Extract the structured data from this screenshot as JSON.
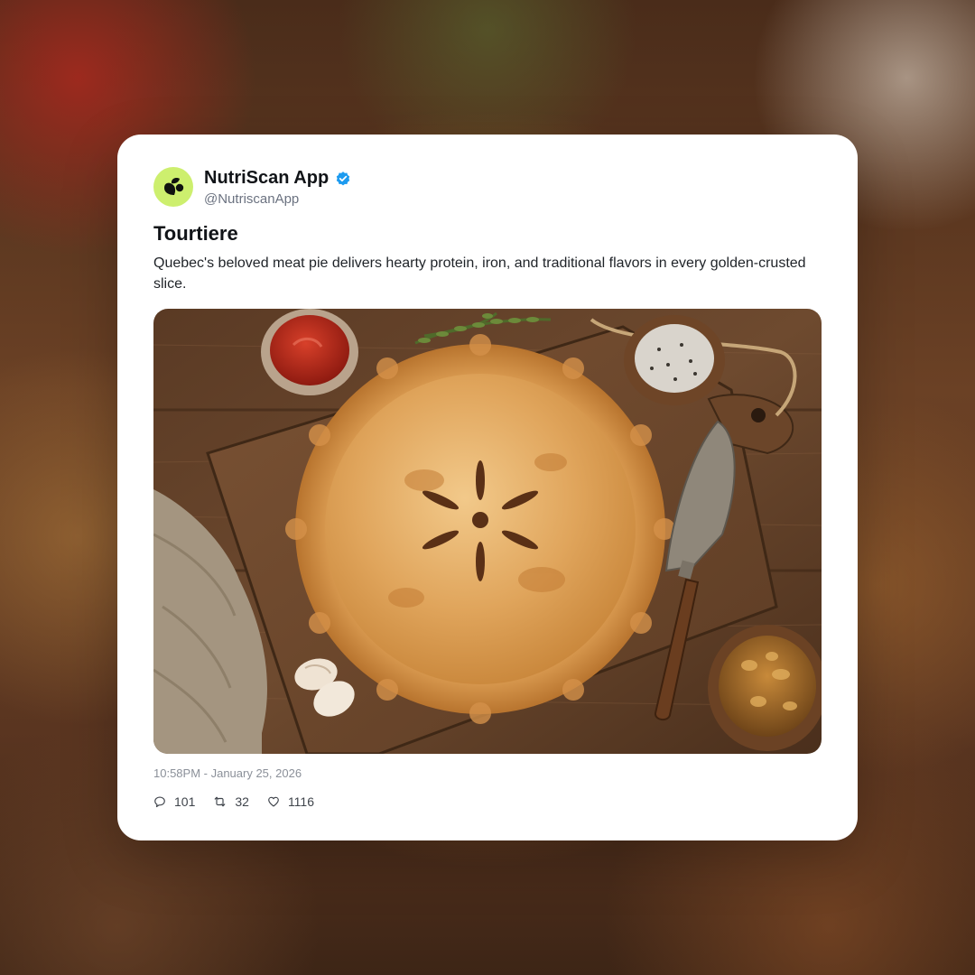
{
  "post": {
    "account_name": "NutriScan App",
    "handle": "@NutriscanApp",
    "verified": true,
    "title": "Tourtiere",
    "description": "Quebec's beloved meat pie delivers hearty protein, iron, and traditional flavors in every golden-crusted slice.",
    "timestamp": "10:58PM - January 25, 2026",
    "stats": {
      "replies": "101",
      "reposts": "32",
      "likes": "1116"
    }
  },
  "icons": {
    "avatar": "leaf-logo-icon",
    "verified": "verified-badge-icon",
    "replies": "comment-icon",
    "reposts": "repost-icon",
    "likes": "heart-icon"
  },
  "colors": {
    "avatar_bg": "#cdef6e",
    "verified_blue": "#1d9bf0",
    "card_bg": "#ffffff"
  }
}
